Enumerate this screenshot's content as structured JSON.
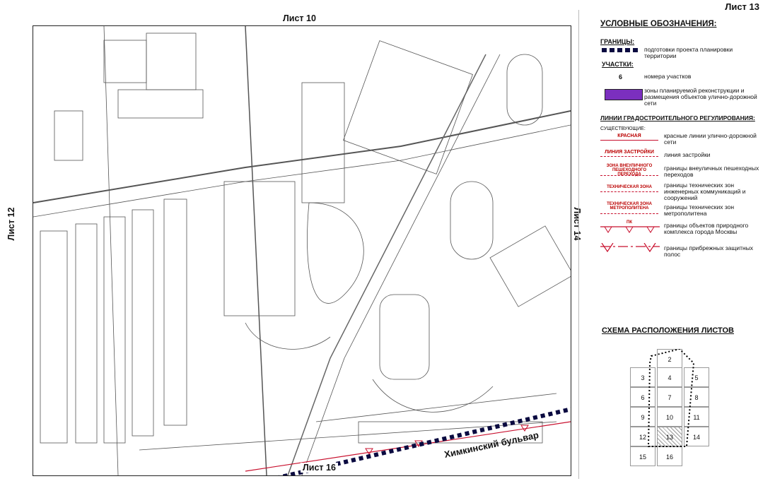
{
  "sheet_title": "Лист 13",
  "map": {
    "ref_top": "Лист 10",
    "ref_bottom": "Лист 16",
    "ref_left": "Лист 12",
    "ref_right": "Лист 14",
    "street_label": "Химкинский бульвар"
  },
  "legend": {
    "title": "УСЛОВНЫЕ ОБОЗНАЧЕНИЯ:",
    "boundaries_heading": "ГРАНИЦЫ:",
    "boundary_project": "подготовки проекта планировки территории",
    "plots_heading": "УЧАСТКИ:",
    "plot_number_sample": "6",
    "plot_number_desc": "номера участков",
    "zone_desc": "зоны планируемой реконструкции и размещения объектов улично-дорожной сети",
    "lines_heading": "ЛИНИИ ГРАДОСТРОИТЕЛЬНОГО РЕГУЛИРОВАНИЯ:",
    "existing_label": "СУЩЕСТВУЮЩИЕ:",
    "items": [
      {
        "tag": "КРАСНАЯ",
        "desc": "красные линии улично-дорожной сети"
      },
      {
        "tag": "ЛИНИЯ ЗАСТРОЙКИ",
        "desc": "линия застройки"
      },
      {
        "tag": "ЗОНА ВНЕУЛИЧНОГО ПЕШЕХОДНОГО ПЕРЕХОДА",
        "desc": "границы внеуличных пешеходных переходов"
      },
      {
        "tag": "ТЕХНИЧЕСКАЯ ЗОНА",
        "desc": "границы технических зон инженерных коммуникаций и сооружений"
      },
      {
        "tag": "ТЕХНИЧЕСКАЯ ЗОНА МЕТРОПОЛИТЕНА",
        "desc": "границы технических зон метрополитена"
      },
      {
        "tag": "ПК",
        "desc": "границы объектов природного комплекса города Москвы"
      },
      {
        "tag": "",
        "desc": "границы прибрежных защитных полос"
      }
    ],
    "colors": {
      "red": "#c8102e",
      "zone": "#7b2fbf",
      "boundary": "#0a0a40"
    }
  },
  "scheme": {
    "title": "СХЕМА РАСПОЛОЖЕНИЯ ЛИСТОВ",
    "cells": [
      "2",
      "3",
      "4",
      "5",
      "6",
      "7",
      "8",
      "9",
      "10",
      "11",
      "12",
      "13",
      "14",
      "15",
      "16"
    ],
    "active": "13"
  }
}
